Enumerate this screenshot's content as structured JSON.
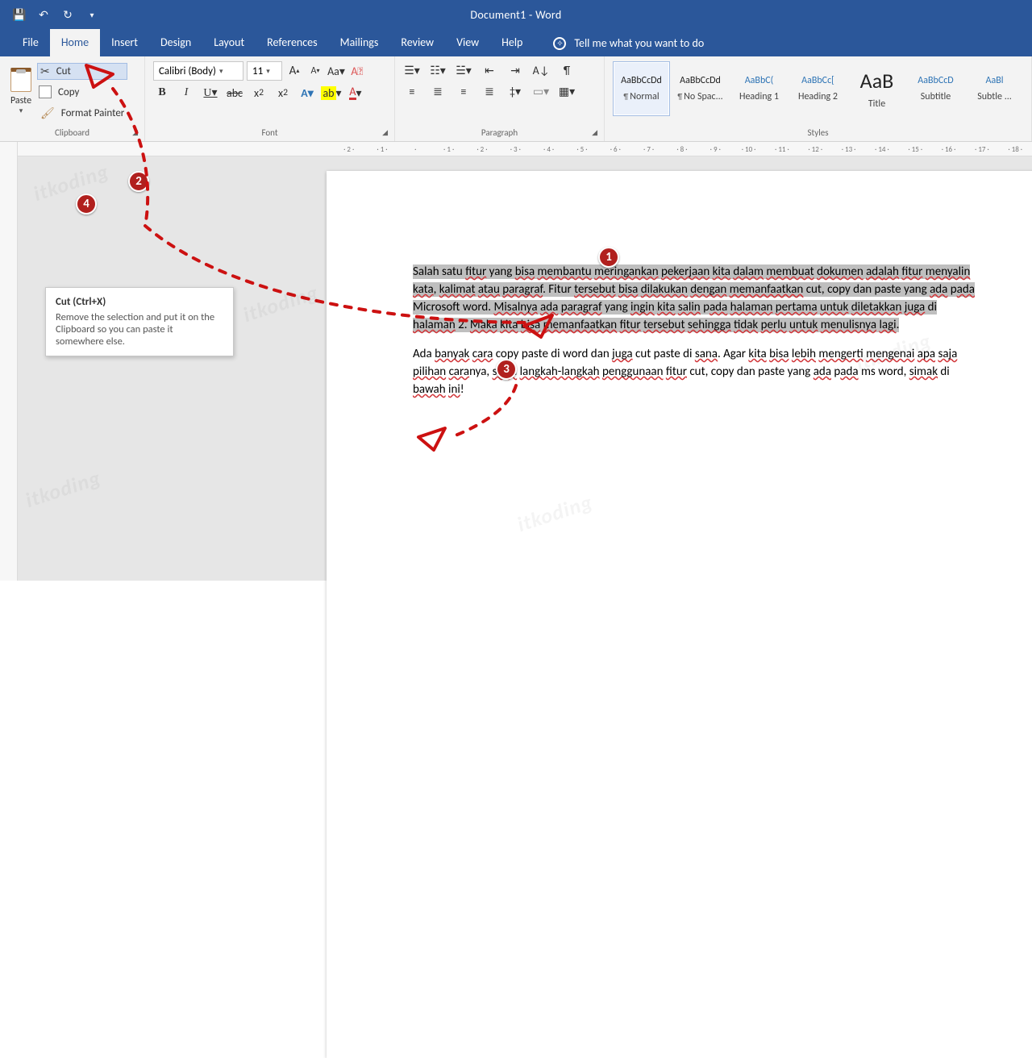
{
  "titlebar": {
    "document_title": "Document1  -  Word"
  },
  "tabs": {
    "file": "File",
    "home": "Home",
    "insert": "Insert",
    "design": "Design",
    "layout": "Layout",
    "references": "References",
    "mailings": "Mailings",
    "review": "Review",
    "view": "View",
    "help": "Help",
    "tell_me": "Tell me what you want to do"
  },
  "clipboard": {
    "paste": "Paste",
    "cut": "Cut",
    "copy": "Copy",
    "format_painter": "Format Painter",
    "group_label": "Clipboard"
  },
  "font": {
    "family": "Calibri (Body)",
    "size": "11",
    "group_label": "Font"
  },
  "paragraph": {
    "group_label": "Paragraph"
  },
  "styles": {
    "group_label": "Styles",
    "items": [
      {
        "preview": "AaBbCcDd",
        "label": "Normal",
        "para": true,
        "sel": true
      },
      {
        "preview": "AaBbCcDd",
        "label": "No Spac...",
        "para": true
      },
      {
        "preview": "AaBbC(",
        "label": "Heading 1",
        "heading": true
      },
      {
        "preview": "AaBbCc[",
        "label": "Heading 2",
        "heading": true
      },
      {
        "preview": "AaB",
        "label": "Title",
        "title": true
      },
      {
        "preview": "AaBbCcD",
        "label": "Subtitle",
        "heading": true
      },
      {
        "preview": "AaBl",
        "label": "Subtle ...",
        "heading": true
      }
    ]
  },
  "tooltip": {
    "title": "Cut (Ctrl+X)",
    "body": "Remove the selection and put it on the Clipboard so you can paste it somewhere else."
  },
  "document": {
    "p1": "Salah satu fitur yang bisa membantu meringankan pekerjaan kita dalam membuat dokumen adalah fitur menyalin kata, kalimat atau paragraf. Fitur tersebut bisa dilakukan dengan memanfaatkan cut, copy dan paste yang ada pada Microsoft word. Misalnya ada paragraf yang ingin kita salin pada halaman pertama untuk diletakkan juga di halaman 2. Maka kita bisa memanfaatkan fitur tersebut sehingga tidak perlu untuk menulisnya lagi.",
    "p2": "Ada banyak cara copy paste di word dan juga cut paste di sana. Agar kita bisa lebih mengerti mengenai apa saja pilihan caranya, serta langkah-langkah penggunaan fitur cut, copy dan paste yang ada pada ms word, simak di bawah ini!"
  },
  "ruler": {
    "marks": [
      "2",
      "1",
      "",
      "1",
      "2",
      "3",
      "4",
      "5",
      "6",
      "7",
      "8",
      "9",
      "10",
      "11",
      "12",
      "13",
      "14",
      "15",
      "16",
      "17",
      "18"
    ]
  },
  "annotations": {
    "b1": "1",
    "b2": "2",
    "b3": "3",
    "b4": "4"
  },
  "watermark": "itkoding"
}
